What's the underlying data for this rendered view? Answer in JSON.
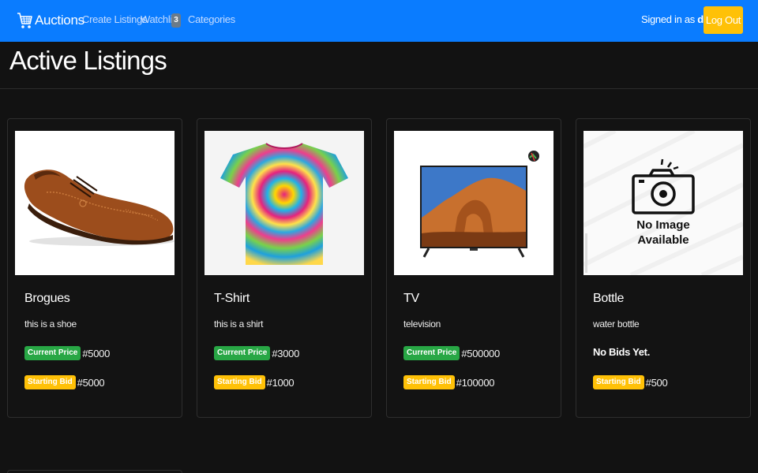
{
  "navbar": {
    "brand": "Auctions",
    "brand_icon": "cart-icon",
    "links": {
      "create": "Create Listings",
      "watchlist": "Watchlist",
      "categories": "Categories"
    },
    "watchlist_count": "3",
    "signed_in_prefix": "Signed in as",
    "username": "dini",
    "signed_in_suffix": ".",
    "logout": "Log Out",
    "color": "#0a7cff"
  },
  "page": {
    "title": "Active Listings",
    "background": "#121212"
  },
  "listings": [
    {
      "image": "brogue-shoe-photo",
      "title": "Brogues",
      "description": "this is a shoe",
      "current_price_label": "Current Price",
      "current_price": "#5000",
      "starting_bid_label": "Starting Bid",
      "starting_bid": "#5000"
    },
    {
      "image": "tie-dye-tshirt-photo",
      "title": "T-Shirt",
      "description": "this is a shirt",
      "current_price_label": "Current Price",
      "current_price": "#3000",
      "starting_bid_label": "Starting Bid",
      "starting_bid": "#1000"
    },
    {
      "image": "television-photo",
      "title": "TV",
      "description": "television",
      "current_price_label": "Current Price",
      "current_price": "#500000",
      "starting_bid_label": "Starting Bid",
      "starting_bid": "#100000"
    },
    {
      "image": "no-image-placeholder",
      "image_text_1": "No Image",
      "image_text_2": "Available",
      "title": "Bottle",
      "description": "water bottle",
      "no_bids": "No Bids Yet.",
      "starting_bid_label": "Starting Bid",
      "starting_bid": "#500"
    }
  ],
  "colors": {
    "current_price_badge": "#28a745",
    "starting_bid_badge": "#ffc107",
    "logout_button": "#ffc107"
  }
}
